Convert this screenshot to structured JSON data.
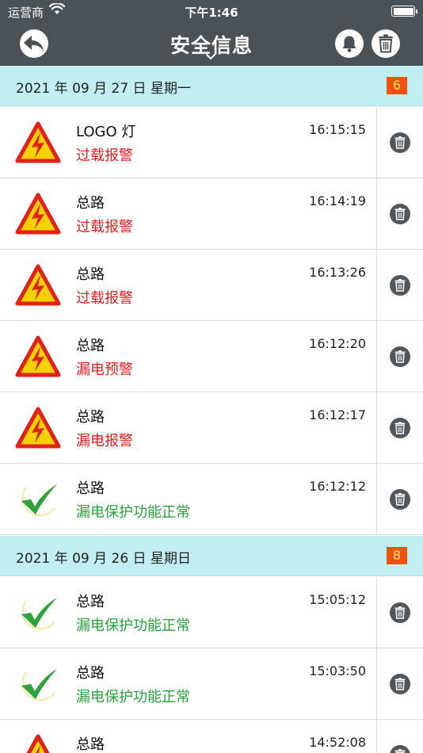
{
  "status_bar": {
    "carrier": "运营商",
    "time": "下午1:46"
  },
  "header": {
    "title": "安全信息"
  },
  "sections": [
    {
      "date": "2021 年 09 月 27 日  星期一",
      "count": "6",
      "items": [
        {
          "name": "LOGO 灯",
          "status": "过载报警",
          "time": "16:15:15",
          "kind": "alarm"
        },
        {
          "name": "总路",
          "status": "过载报警",
          "time": "16:14:19",
          "kind": "alarm"
        },
        {
          "name": "总路",
          "status": "过载报警",
          "time": "16:13:26",
          "kind": "alarm"
        },
        {
          "name": "总路",
          "status": "漏电预警",
          "time": "16:12:20",
          "kind": "alarm"
        },
        {
          "name": "总路",
          "status": "漏电报警",
          "time": "16:12:17",
          "kind": "alarm"
        },
        {
          "name": "总路",
          "status": "漏电保护功能正常",
          "time": "16:12:12",
          "kind": "normal"
        }
      ]
    },
    {
      "date": "2021 年 09 月 26 日  星期日",
      "count": "8",
      "items": [
        {
          "name": "总路",
          "status": "漏电保护功能正常",
          "time": "15:05:12",
          "kind": "normal"
        },
        {
          "name": "总路",
          "status": "漏电保护功能正常",
          "time": "15:03:50",
          "kind": "normal"
        },
        {
          "name": "总路",
          "status": "",
          "time": "14:52:08",
          "kind": "alarm"
        }
      ]
    }
  ],
  "icons": {
    "alarm": "electric-hazard-warning-icon",
    "normal": "green-checkmark-icon",
    "delete": "trash-icon"
  },
  "colors": {
    "nav_bar": "#4a5157",
    "section_bg": "#c0eef1",
    "badge_bg": "#f0530e",
    "badge_text": "#ffe56a",
    "alarm_text": "#e0201c",
    "normal_text": "#27a33a"
  }
}
